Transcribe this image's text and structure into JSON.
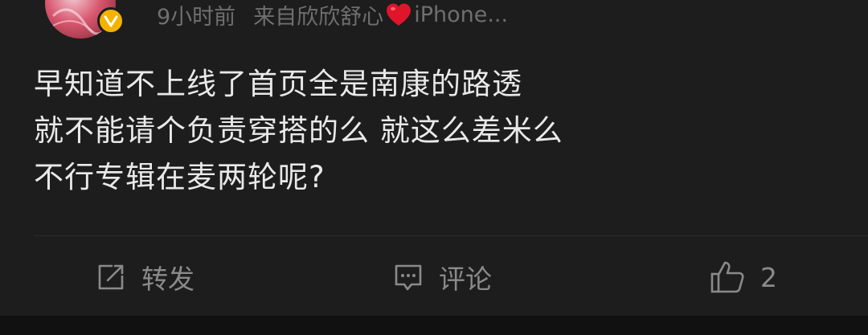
{
  "post": {
    "time": "9小时前",
    "source_prefix": "来自欣欣舒心",
    "source_suffix": "iPhone...",
    "verified_badge": "V",
    "content_lines": [
      "早知道不上线了首页全是南康的路透",
      "就不能请个负责穿搭的么 就这么差米么",
      "不行专辑在麦两轮呢?"
    ]
  },
  "actions": {
    "repost_label": "转发",
    "comment_label": "评论",
    "like_count": "2"
  },
  "icons": {
    "repost": "repost-icon",
    "comment": "comment-icon",
    "like": "thumbs-up-icon",
    "heart": "heart-emoji-icon"
  },
  "colors": {
    "background": "#1d1d1d",
    "text_primary": "#e9e9e9",
    "text_secondary": "#6f6f6f",
    "action_gray": "#8a8a8a",
    "badge_gold": "#f5b301",
    "heart_red": "#e0142a"
  }
}
